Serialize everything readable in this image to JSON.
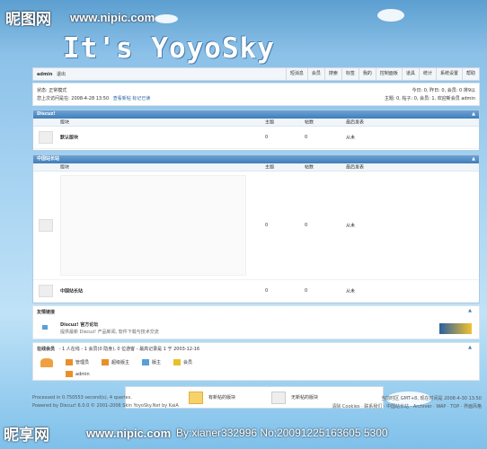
{
  "watermark": {
    "site": "昵图网",
    "url": "www.nipic.com",
    "bottom_site": "昵享网",
    "bottom_url": "www.nipic.com",
    "bottom_id": "By:xianer332996 No:20091225163605 5300"
  },
  "logo": {
    "text": "It's YoyoSky"
  },
  "topbar": {
    "user": "admin",
    "logout": "退出",
    "nav": [
      "短消息",
      "会员",
      "搜索",
      "标签",
      "我的",
      "控制面板",
      "道具",
      "统计",
      "系统设置",
      "帮助"
    ]
  },
  "infobar": {
    "status": "状态: 正常模式",
    "last_visit": "您上次访问是在: 2008-4-28 13:50",
    "links": "查看新帖  标记已读",
    "today_stats": "今日: 0, 昨日: 0, 会员: 0  排9以",
    "overall_stats": "主题: 0, 帖子: 0, 会员: 1, 欢迎新会员 admin"
  },
  "forums": [
    {
      "category": "Discuz!",
      "columns": {
        "forum": "版块",
        "topics": "主题",
        "posts": "帖数",
        "last": "最后发表"
      },
      "rows": [
        {
          "name": "默认版块",
          "topics": "0",
          "posts": "0",
          "last": "从未"
        }
      ]
    },
    {
      "category": "中国站长站",
      "columns": {
        "forum": "版块",
        "topics": "主题",
        "posts": "帖数",
        "last": "最后发表"
      },
      "rows": [
        {
          "name": "",
          "topics": "0",
          "posts": "0",
          "last": "从未"
        },
        {
          "name": "中国站长站",
          "topics": "0",
          "posts": "0",
          "last": "从未"
        }
      ]
    }
  ],
  "friend": {
    "title": "友情链接",
    "name": "Discuz! 官方论坛",
    "desc": "提供最新 Discuz! 产品新闻, 软件下载与技术交流"
  },
  "online": {
    "title": "在线会员",
    "summary": "- 1 人在线 - 1 会员(0 隐身), 0 位游客 - 最高记录是 1 于 2003-12-16",
    "groups": [
      "管理员",
      "超级版主",
      "版主",
      "会员"
    ],
    "member": "admin"
  },
  "legend": {
    "new": "有新帖的版块",
    "none": "无新帖的版块"
  },
  "footer": {
    "powered": "Processed in 0.750553 second(s), 4 queries.",
    "copyright": "Powered by Discuz! 6.0.0 © 2001-2006 Skin YoyoSky.Net by KaiA",
    "time": "当前时区 GMT+8, 现在时间是 2008-4-30 13:50",
    "links": "清除 Cookies · 联系我们 · 中国站长站 · Archiver · WAP · TOP · 界面风格"
  },
  "colors": {
    "header_blue": "#3f7db9",
    "sky_top": "#5c9fd0",
    "sky_bottom": "#bfe2f7"
  }
}
